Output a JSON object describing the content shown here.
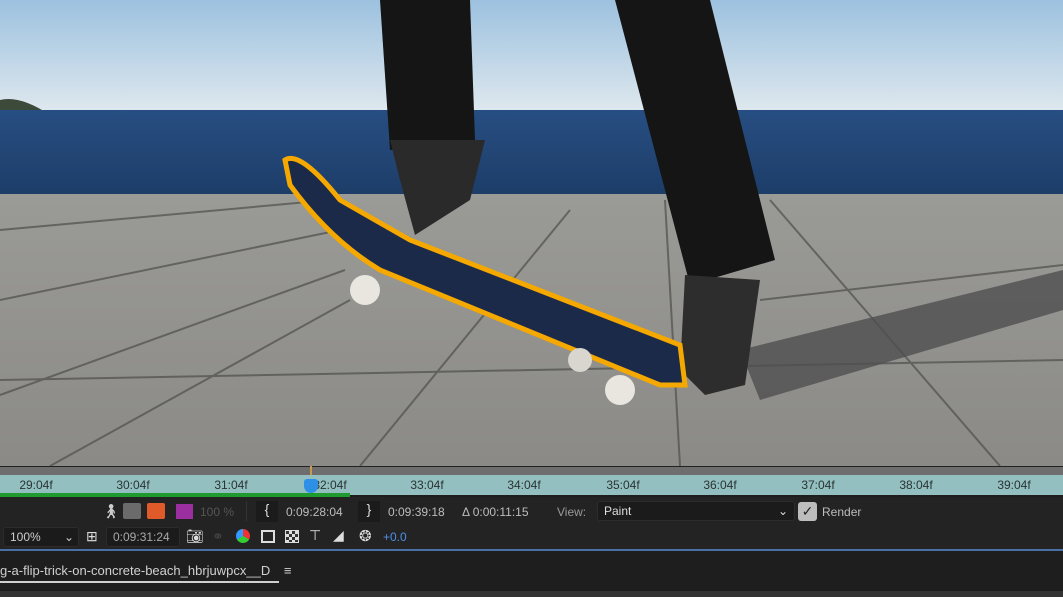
{
  "viewer": {
    "content": "skateboarder flip trick on concrete beach with paint stroke outline",
    "stroke_color": "#f5a800"
  },
  "ruler": {
    "ticks": [
      "29:04f",
      "30:04f",
      "31:04f",
      "32:04f",
      "33:04f",
      "34:04f",
      "35:04f",
      "36:04f",
      "37:04f",
      "38:04f",
      "39:04f"
    ],
    "playhead_label": "32:04f"
  },
  "toolbar1": {
    "opacity": "100 %",
    "in_point": "0:09:28:04",
    "out_point": "0:09:39:18",
    "duration": "Δ 0:00:11:15",
    "view_label": "View:",
    "view_value": "Paint",
    "render_label": "Render",
    "render_checked": true,
    "swatch_color": "#9b2fa0"
  },
  "toolbar2": {
    "zoom": "100%",
    "timecode": "0:09:31:24",
    "exposure": "+0.0"
  },
  "tab": {
    "title": "g-a-flip-trick-on-concrete-beach_hbrjuwpcx__D",
    "menu_icon": "≡"
  }
}
